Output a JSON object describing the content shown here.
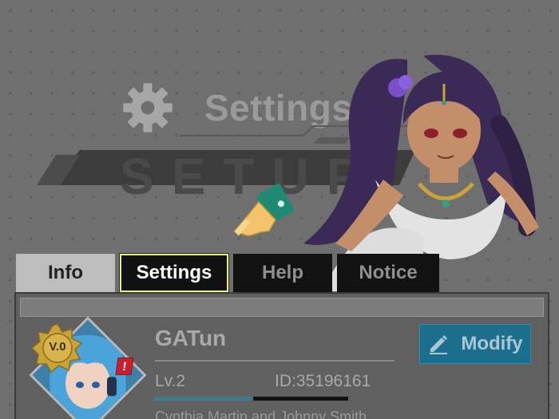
{
  "header": {
    "title": "Settings",
    "banner": "SETUP",
    "icon": "gear-icon"
  },
  "tabs": [
    {
      "id": "info",
      "label": "Info",
      "active": false
    },
    {
      "id": "settings",
      "label": "Settings",
      "active": true
    },
    {
      "id": "help",
      "label": "Help",
      "active": false
    },
    {
      "id": "notice",
      "label": "Notice",
      "active": false
    }
  ],
  "profile": {
    "name": "GATun",
    "level": "Lv.2",
    "id": "ID:35196161",
    "badge": "V.0",
    "alert": "!",
    "exp_progress": 0.51,
    "footer_text": "Cynthia Martin and Johnny Smith"
  },
  "actions": {
    "modify_label": "Modify",
    "modify_icon": "pencil-icon"
  },
  "colors": {
    "accent": "#1c6f8c",
    "active_tab_border": "#e8ef7a",
    "alert": "#c8202e"
  }
}
